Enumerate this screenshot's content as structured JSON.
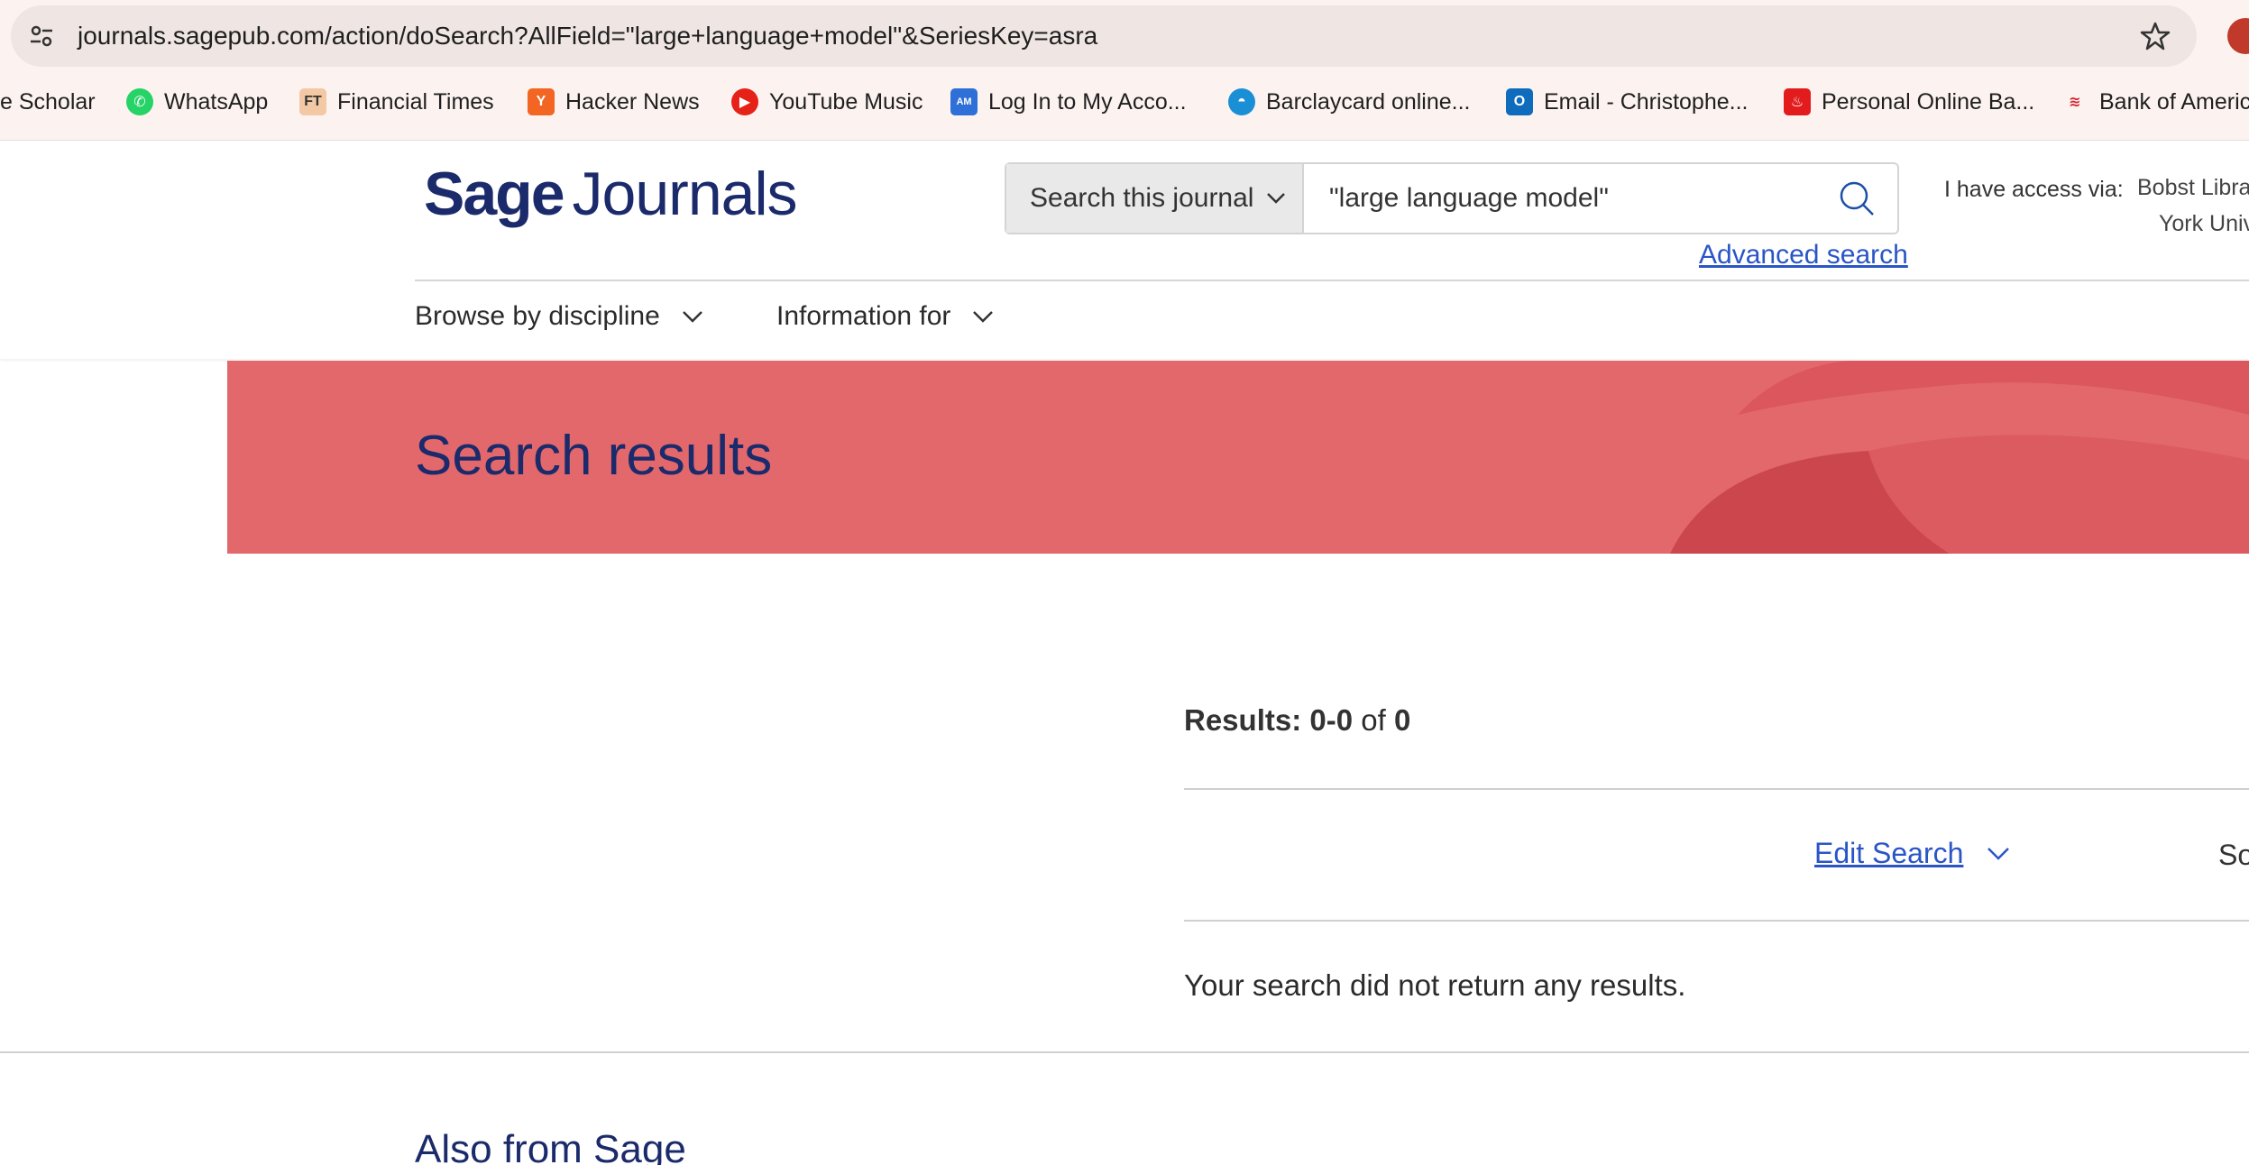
{
  "browser": {
    "url": "journals.sagepub.com/action/doSearch?AllField=\"large+language+model\"&SeriesKey=asra",
    "bookmarks": [
      {
        "label": "e Scholar",
        "icon": "",
        "color": ""
      },
      {
        "label": "WhatsApp",
        "icon": "whatsapp-icon",
        "color": "#25d366"
      },
      {
        "label": "Financial Times",
        "icon": "ft-icon",
        "color": "#f2c8a5"
      },
      {
        "label": "Hacker News",
        "icon": "hacker-news-icon",
        "color": "#f26522"
      },
      {
        "label": "YouTube Music",
        "icon": "youtube-music-icon",
        "color": "#e62117"
      },
      {
        "label": "Log In to My Acco...",
        "icon": "amex-icon",
        "color": "#2e6fd8"
      },
      {
        "label": "Barclaycard online...",
        "icon": "barclaycard-icon",
        "color": "#1a8fd6"
      },
      {
        "label": "Email - Christophe...",
        "icon": "outlook-icon",
        "color": "#0f6cbd"
      },
      {
        "label": "Personal Online Ba...",
        "icon": "santander-icon",
        "color": "#e21c1c"
      },
      {
        "label": "Bank of Americ",
        "icon": "bank-of-america-icon",
        "color": "#d6232f"
      }
    ]
  },
  "header": {
    "logo_sage": "Sage",
    "logo_journals": "Journals",
    "search_scope": "Search this journal",
    "search_value": "\"large language model\"",
    "advanced_search": "Advanced search",
    "access_label": "I have access via:",
    "access_inst_line1": "Bobst Libra",
    "access_inst_line2": "York Univ",
    "nav": {
      "browse": "Browse by discipline",
      "info": "Information for"
    }
  },
  "hero": {
    "title": "Search results"
  },
  "results": {
    "label": "Results:",
    "range": "0-0",
    "of": "of",
    "total": "0",
    "edit_search": "Edit Search",
    "sort_label": "So",
    "message": "Your search did not return any results."
  },
  "footer": {
    "also_from": "Also from Sage"
  },
  "colors": {
    "brand_navy": "#1b2a6b",
    "hero_red": "#e2686c",
    "link_blue": "#2a55c7"
  }
}
